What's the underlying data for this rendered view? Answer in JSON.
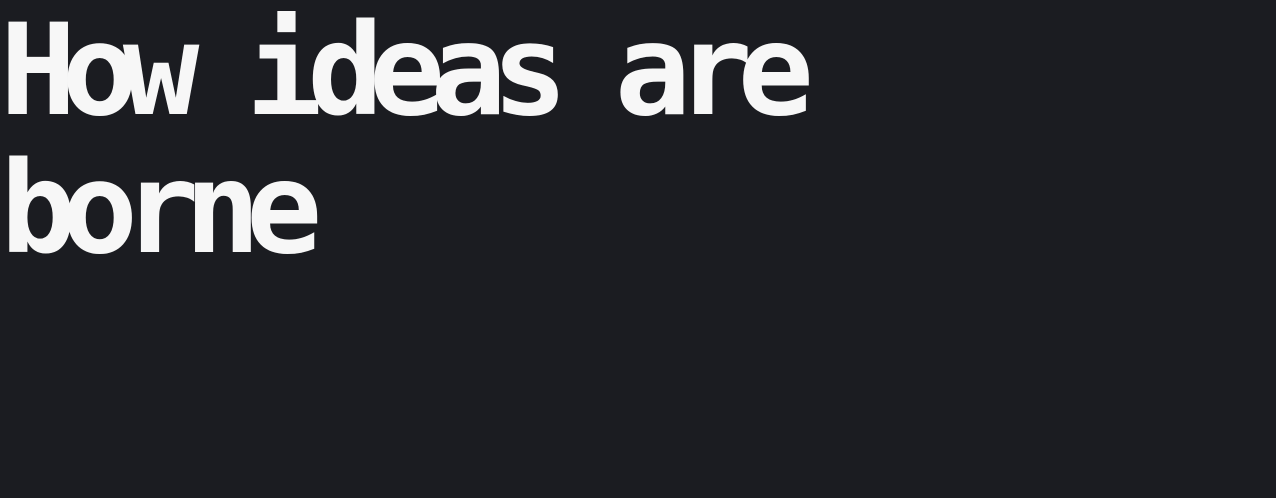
{
  "hero": {
    "title": "How ideas are borne"
  },
  "colors": {
    "background": "#1b1c21",
    "text": "#f7f7f7"
  }
}
